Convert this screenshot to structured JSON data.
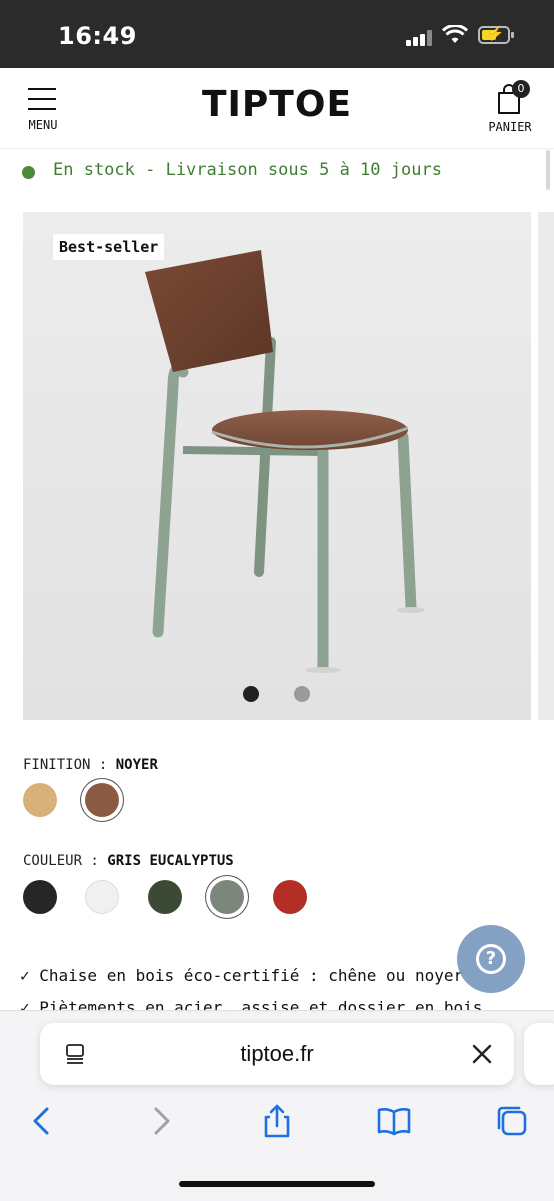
{
  "status_bar": {
    "time": "16:49"
  },
  "header": {
    "menu_label": "MENU",
    "logo": "TIPTOE",
    "cart_label": "PANIER",
    "cart_count": "0"
  },
  "stock": {
    "text": "En stock - Livraison sous 5 à 10 jours",
    "color": "#4e8a3c"
  },
  "gallery": {
    "badge": "Best-seller",
    "active_image": 1,
    "image_count": 2
  },
  "finish": {
    "label": "FINITION :",
    "value": "NOYER",
    "options": [
      {
        "name": "chene",
        "color": "#d8b07a",
        "selected": false
      },
      {
        "name": "noyer",
        "color": "#8a5a43",
        "selected": true
      }
    ]
  },
  "colour": {
    "label": "COULEUR :",
    "value": "GRIS EUCALYPTUS",
    "options": [
      {
        "name": "noir",
        "color": "#262626",
        "selected": false
      },
      {
        "name": "blanc",
        "color": "#f0f0f2",
        "selected": false
      },
      {
        "name": "vert",
        "color": "#3c4a35",
        "selected": false
      },
      {
        "name": "gris-eucalyptus",
        "color": "#7c877c",
        "selected": true
      },
      {
        "name": "rouge",
        "color": "#b32f26",
        "selected": false
      }
    ]
  },
  "features": [
    "✓ Chaise en bois éco-certifié : chêne ou noyer",
    "✓ Piètements en acier, assise et dossier en bois"
  ],
  "safari": {
    "url": "tiptoe.fr"
  },
  "icons": {
    "menu": "hamburger-icon",
    "cart": "shopping-bag-icon",
    "help": "question-mark-icon",
    "reader": "reader-mode-icon",
    "close": "close-icon",
    "back": "chevron-left-icon",
    "forward": "chevron-right-icon",
    "share": "share-icon",
    "bookmarks": "book-icon",
    "tabs": "tabs-icon"
  }
}
